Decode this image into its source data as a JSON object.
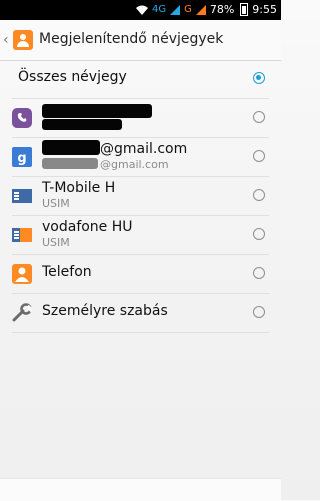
{
  "status_bar": {
    "network_1": "4G",
    "network_2": "G",
    "battery": "78%",
    "time": "9:55"
  },
  "header": {
    "title": "Megjelenítendő névjegyek"
  },
  "list": [
    {
      "label": "Összes névjegy",
      "selected": true
    },
    {
      "label": "",
      "icon": "viber-icon",
      "selected": false
    },
    {
      "label": "@gmail.com",
      "sub": "@gmail.com",
      "icon": "google-icon",
      "selected": false
    },
    {
      "label": "T-Mobile H",
      "sub": "USIM",
      "icon": "sim-card-icon",
      "selected": false
    },
    {
      "label": "vodafone HU",
      "sub": "USIM",
      "icon": "sim-card-icon",
      "selected": false
    },
    {
      "label": "Telefon",
      "icon": "phone-contacts-icon",
      "selected": false
    },
    {
      "label": "Személyre szabás",
      "icon": "wrench-icon",
      "selected": false
    }
  ],
  "colors": {
    "accent": "#1a9fd6",
    "orange": "#ff8a23",
    "viber": "#7b519d",
    "google": "#3a7bd5"
  }
}
